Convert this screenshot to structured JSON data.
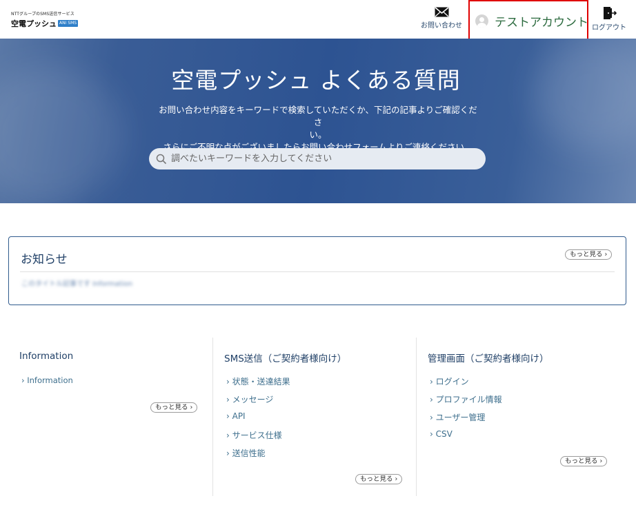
{
  "header": {
    "logo_tagline": "NTTグループのSMS送信サービス",
    "logo_name": "空電プッシュ",
    "logo_badge": "ANI SMS",
    "contact_label": "お問い合わせ",
    "contact_icon": "envelope-icon",
    "account_name": "テストアカウント",
    "account_icon": "user-avatar-icon",
    "logout_label": "ログアウト",
    "logout_icon": "exit-door-icon",
    "highlight_color": "#e00000"
  },
  "hero": {
    "title": "空電プッシュ よくある質問",
    "desc_line1": "お問い合わせ内容をキーワードで検索していただくか、下記の記事よりご確認くださ",
    "desc_line2": "い。",
    "desc_line3": "さらにご不明な点がございましたらお問い合わせフォームよりご連絡ください。",
    "search_placeholder": "調べたいキーワードを入力してください",
    "search_value": ""
  },
  "news": {
    "title": "お知らせ",
    "more_label": "もっと見る ›",
    "item": "このタイトル記事です Information"
  },
  "categories": [
    {
      "title": "Information",
      "items": [
        "› Information"
      ],
      "more_label": "もっと見る ›"
    },
    {
      "title": "SMS送信（ご契約者様向け）",
      "items": [
        "› 状態・送達結果",
        "› メッセージ",
        "› API",
        "› サービス仕様",
        "› 送信性能"
      ],
      "more_label": "もっと見る ›"
    },
    {
      "title": "管理画面（ご契約者様向け）",
      "items": [
        "› ログイン",
        "› プロファイル情報",
        "› ユーザー管理",
        "› CSV"
      ],
      "more_label": "もっと見る ›"
    }
  ]
}
